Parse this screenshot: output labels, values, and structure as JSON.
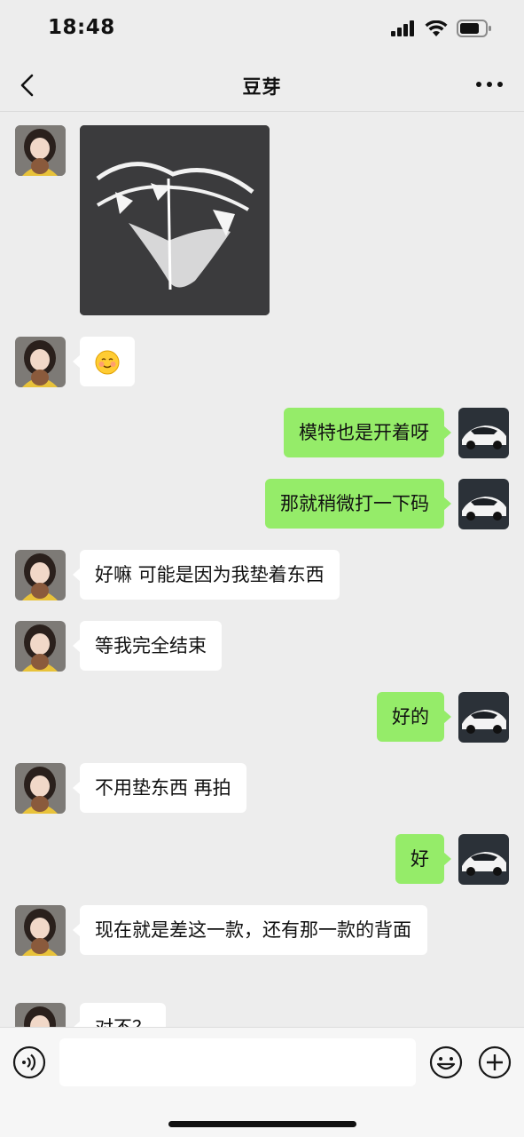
{
  "status_bar": {
    "time": "18:48"
  },
  "nav": {
    "title": "豆芽"
  },
  "messages": [
    {
      "side": "left",
      "type": "image"
    },
    {
      "side": "left",
      "type": "emoji",
      "text": "☺"
    },
    {
      "side": "right",
      "type": "text",
      "text": "模特也是开着呀"
    },
    {
      "side": "right",
      "type": "text",
      "text": "那就稍微打一下码"
    },
    {
      "side": "left",
      "type": "text",
      "text": "好嘛 可能是因为我垫着东西"
    },
    {
      "side": "left",
      "type": "text",
      "text": "等我完全结束"
    },
    {
      "side": "right",
      "type": "text",
      "text": "好的"
    },
    {
      "side": "left",
      "type": "text",
      "text": "不用垫东西 再拍"
    },
    {
      "side": "right",
      "type": "text",
      "text": "好"
    },
    {
      "side": "left",
      "type": "text",
      "text": "现在就是差这一款，还有那一款的背面"
    },
    {
      "side": "left",
      "type": "text",
      "text": "对不？"
    }
  ],
  "colors": {
    "self_bubble": "#95ec69",
    "other_bubble": "#ffffff",
    "background": "#ededed"
  },
  "icons": {
    "back": "chevron-left-icon",
    "more": "more-dots-icon",
    "voice": "voice-icon",
    "emoji": "emoji-icon",
    "plus": "plus-icon"
  }
}
